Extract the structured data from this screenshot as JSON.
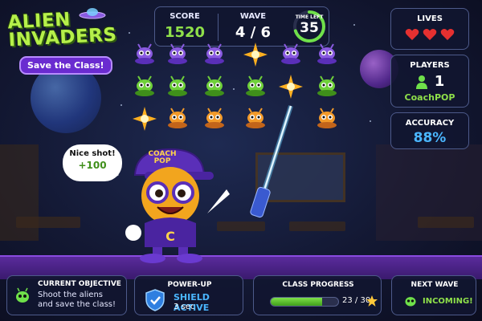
{
  "logo": {
    "title_line1": "ALIEN",
    "title_line2": "INVADERS",
    "subtitle": "Save the Class!"
  },
  "hud": {
    "score_label": "SCORE",
    "score": "1520",
    "wave_label": "WAVE",
    "wave": "4 / 6",
    "time_label": "TIME LEFT",
    "time": "35",
    "time_fraction": 0.7
  },
  "lives": {
    "label": "LIVES",
    "count": 3,
    "icon": "heart-icon"
  },
  "players": {
    "label": "PLAYERS",
    "count": "1",
    "name": "CoachPOP"
  },
  "accuracy": {
    "label": "ACCURACY",
    "value": "88%"
  },
  "alien_grid": {
    "rows": [
      [
        "purple",
        "purple",
        "purple",
        "explosion-purple",
        "purple",
        "purple"
      ],
      [
        "green",
        "green",
        "green",
        "green",
        "explosion",
        "green"
      ],
      [
        "explosion",
        "orange",
        "orange",
        "orange",
        "",
        "orange"
      ]
    ]
  },
  "character": {
    "cap_text_1": "COACH",
    "cap_text_2": "POP"
  },
  "speech": {
    "line1": "Nice shot!",
    "line2": "+100"
  },
  "bottom": {
    "objective_label": "CURRENT OBJECTIVE",
    "objective_line1": "Shoot the aliens",
    "objective_line2": "and save the class!",
    "powerup_label": "POWER-UP",
    "powerup_status": "SHIELD ACTIVE",
    "powerup_time": "3 sec",
    "progress_label": "CLASS PROGRESS",
    "progress_text": "23 / 30",
    "progress_fraction": 0.767,
    "next_wave_label": "NEXT WAVE",
    "next_wave_status": "INCOMING!"
  },
  "colors": {
    "accent_green": "#8fe04a",
    "accent_blue": "#4ab6ff",
    "accent_purple": "#6a2bd0",
    "heart_red": "#e53030"
  }
}
